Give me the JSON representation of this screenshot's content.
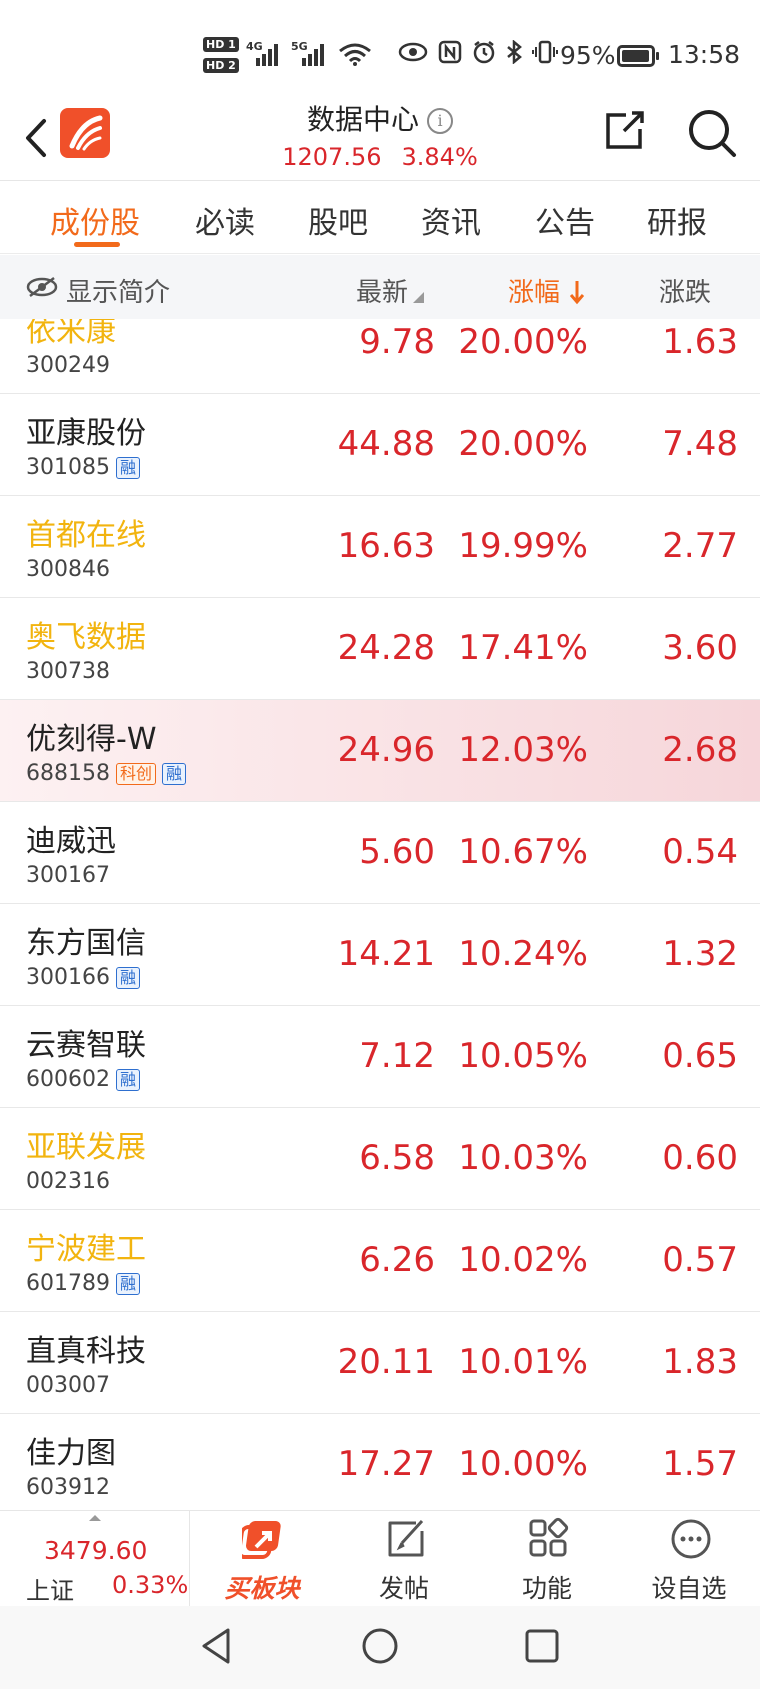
{
  "status_bar": {
    "hd1": "HD 1",
    "hd2": "HD 2",
    "net1": "4G",
    "net2": "5G",
    "battery_pct": "95%",
    "time": "13:58"
  },
  "header": {
    "title": "数据中心",
    "info_symbol": "i",
    "index_value": "1207.56",
    "index_change": "3.84%"
  },
  "tabs": [
    {
      "label": "成份股",
      "active": true
    },
    {
      "label": "必读"
    },
    {
      "label": "股吧"
    },
    {
      "label": "资讯"
    },
    {
      "label": "公告"
    },
    {
      "label": "研报"
    }
  ],
  "columns": {
    "toggle_label": "显示简介",
    "latest": "最新",
    "change_pct": "涨幅",
    "change": "涨跌"
  },
  "rows": [
    {
      "name": "依米康",
      "code": "300249",
      "tags": [],
      "price": "9.78",
      "pct": "20.00%",
      "chg": "1.63",
      "name_color": "yellow"
    },
    {
      "name": "亚康股份",
      "code": "301085",
      "tags": [
        "融"
      ],
      "price": "44.88",
      "pct": "20.00%",
      "chg": "7.48"
    },
    {
      "name": "首都在线",
      "code": "300846",
      "tags": [],
      "price": "16.63",
      "pct": "19.99%",
      "chg": "2.77",
      "name_color": "yellow"
    },
    {
      "name": "奥飞数据",
      "code": "300738",
      "tags": [],
      "price": "24.28",
      "pct": "17.41%",
      "chg": "3.60",
      "name_color": "yellow"
    },
    {
      "name": "优刻得-W",
      "code": "688158",
      "tags": [
        "科创",
        "融"
      ],
      "price": "24.96",
      "pct": "12.03%",
      "chg": "2.68",
      "highlight": true
    },
    {
      "name": "迪威迅",
      "code": "300167",
      "tags": [],
      "price": "5.60",
      "pct": "10.67%",
      "chg": "0.54"
    },
    {
      "name": "东方国信",
      "code": "300166",
      "tags": [
        "融"
      ],
      "price": "14.21",
      "pct": "10.24%",
      "chg": "1.32"
    },
    {
      "name": "云赛智联",
      "code": "600602",
      "tags": [
        "融"
      ],
      "price": "7.12",
      "pct": "10.05%",
      "chg": "0.65"
    },
    {
      "name": "亚联发展",
      "code": "002316",
      "tags": [],
      "price": "6.58",
      "pct": "10.03%",
      "chg": "0.60",
      "name_color": "yellow"
    },
    {
      "name": "宁波建工",
      "code": "601789",
      "tags": [
        "融"
      ],
      "price": "6.26",
      "pct": "10.02%",
      "chg": "0.57",
      "name_color": "yellow"
    },
    {
      "name": "直真科技",
      "code": "003007",
      "tags": [],
      "price": "20.11",
      "pct": "10.01%",
      "chg": "1.83"
    },
    {
      "name": "佳力图",
      "code": "603912",
      "tags": [],
      "price": "17.27",
      "pct": "10.00%",
      "chg": "1.57"
    }
  ],
  "bottom_bar": {
    "index_value": "3479.60",
    "index_name": "上证",
    "index_pct": "0.33%",
    "items": [
      {
        "label": "买板块",
        "icon": "buy-sector-icon"
      },
      {
        "label": "发帖",
        "icon": "compose-icon"
      },
      {
        "label": "功能",
        "icon": "apps-grid-icon"
      },
      {
        "label": "设自选",
        "icon": "more-circle-icon"
      }
    ]
  },
  "colors": {
    "accent": "#f26a1b",
    "up_red": "#d9262b",
    "brand": "#f0502a",
    "highlight_name": "#f2b40f"
  }
}
